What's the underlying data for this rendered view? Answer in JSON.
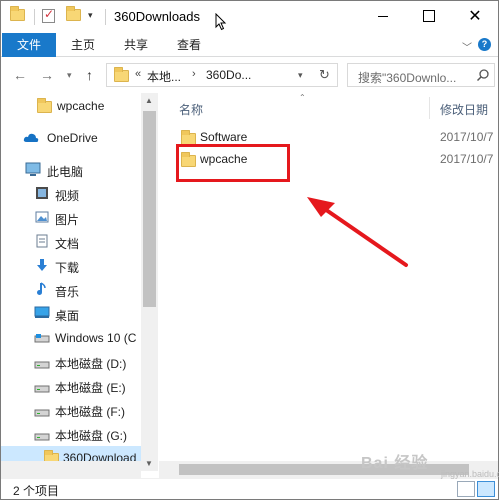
{
  "window": {
    "title": "360Downloads"
  },
  "ribbon": {
    "tabs": [
      "文件",
      "主页",
      "共享",
      "查看"
    ],
    "help_glyph": "?"
  },
  "address": {
    "overflow": "«",
    "segments": [
      "本地...",
      "360Do..."
    ],
    "separator": "›",
    "search_placeholder": "搜索\"360Downlo..."
  },
  "nav_pane": {
    "items": [
      {
        "label": "wpcache",
        "icon": "folder-icon"
      },
      {
        "label": "OneDrive",
        "icon": "onedrive-icon"
      },
      {
        "label": "此电脑",
        "icon": "pc-icon"
      },
      {
        "label": "视频",
        "icon": "video-icon"
      },
      {
        "label": "图片",
        "icon": "picture-icon"
      },
      {
        "label": "文档",
        "icon": "document-icon"
      },
      {
        "label": "下载",
        "icon": "download-icon"
      },
      {
        "label": "音乐",
        "icon": "music-icon"
      },
      {
        "label": "桌面",
        "icon": "desktop-icon"
      },
      {
        "label": "Windows 10 (C",
        "icon": "windows-drive-icon"
      },
      {
        "label": "本地磁盘 (D:)",
        "icon": "drive-icon"
      },
      {
        "label": "本地磁盘 (E:)",
        "icon": "drive-icon"
      },
      {
        "label": "本地磁盘 (F:)",
        "icon": "drive-icon"
      },
      {
        "label": "本地磁盘 (G:)",
        "icon": "drive-icon"
      },
      {
        "label": "360Download",
        "icon": "folder-icon"
      }
    ]
  },
  "content": {
    "columns": {
      "name": "名称",
      "date": "修改日期"
    },
    "rows": [
      {
        "name": "Software",
        "date": "2017/10/7"
      },
      {
        "name": "wpcache",
        "date": "2017/10/7"
      }
    ]
  },
  "status": {
    "count_text": "2 个项目"
  },
  "watermark": {
    "text": "Bai 经验",
    "sub": "jingyan.baidu.com"
  },
  "colors": {
    "accent": "#1979ca",
    "highlight_box": "#e5181d",
    "selected_bg": "#cce8ff",
    "folder": "#f8d775"
  }
}
